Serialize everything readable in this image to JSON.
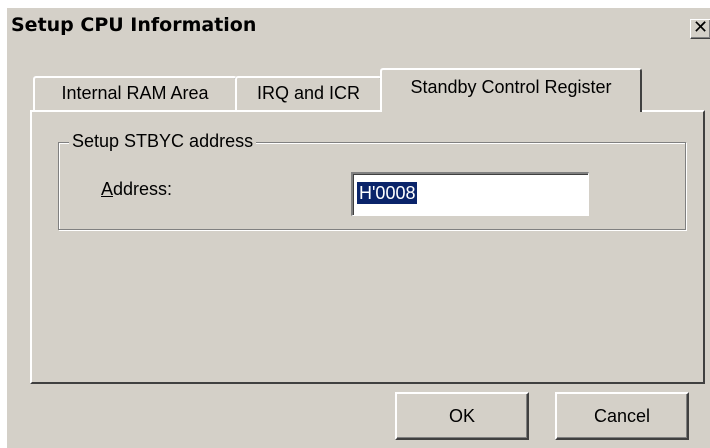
{
  "window": {
    "title": "Setup CPU Information",
    "close_label": "✕"
  },
  "tabs": [
    {
      "label": "Internal RAM Area",
      "active": false
    },
    {
      "label": "IRQ and ICR",
      "active": false
    },
    {
      "label": "Standby Control Register",
      "active": true
    }
  ],
  "group": {
    "label": "Setup STBYC address",
    "field_label_mnemonic": "A",
    "field_label_rest": "ddress:",
    "address_value": "H'0008"
  },
  "buttons": {
    "ok": "OK",
    "cancel": "Cancel"
  },
  "colors": {
    "face": "#d4d0c8",
    "highlight": "#ffffff",
    "shadow": "#404040",
    "selection": "#0a246a"
  }
}
